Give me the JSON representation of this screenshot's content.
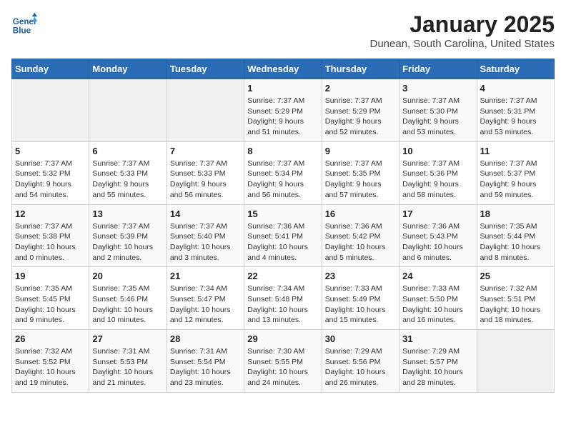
{
  "header": {
    "logo_line1": "General",
    "logo_line2": "Blue",
    "month": "January 2025",
    "location": "Dunean, South Carolina, United States"
  },
  "days_of_week": [
    "Sunday",
    "Monday",
    "Tuesday",
    "Wednesday",
    "Thursday",
    "Friday",
    "Saturday"
  ],
  "weeks": [
    [
      {
        "day": "",
        "info": ""
      },
      {
        "day": "",
        "info": ""
      },
      {
        "day": "",
        "info": ""
      },
      {
        "day": "1",
        "info": "Sunrise: 7:37 AM\nSunset: 5:29 PM\nDaylight: 9 hours\nand 51 minutes."
      },
      {
        "day": "2",
        "info": "Sunrise: 7:37 AM\nSunset: 5:29 PM\nDaylight: 9 hours\nand 52 minutes."
      },
      {
        "day": "3",
        "info": "Sunrise: 7:37 AM\nSunset: 5:30 PM\nDaylight: 9 hours\nand 53 minutes."
      },
      {
        "day": "4",
        "info": "Sunrise: 7:37 AM\nSunset: 5:31 PM\nDaylight: 9 hours\nand 53 minutes."
      }
    ],
    [
      {
        "day": "5",
        "info": "Sunrise: 7:37 AM\nSunset: 5:32 PM\nDaylight: 9 hours\nand 54 minutes."
      },
      {
        "day": "6",
        "info": "Sunrise: 7:37 AM\nSunset: 5:33 PM\nDaylight: 9 hours\nand 55 minutes."
      },
      {
        "day": "7",
        "info": "Sunrise: 7:37 AM\nSunset: 5:33 PM\nDaylight: 9 hours\nand 56 minutes."
      },
      {
        "day": "8",
        "info": "Sunrise: 7:37 AM\nSunset: 5:34 PM\nDaylight: 9 hours\nand 56 minutes."
      },
      {
        "day": "9",
        "info": "Sunrise: 7:37 AM\nSunset: 5:35 PM\nDaylight: 9 hours\nand 57 minutes."
      },
      {
        "day": "10",
        "info": "Sunrise: 7:37 AM\nSunset: 5:36 PM\nDaylight: 9 hours\nand 58 minutes."
      },
      {
        "day": "11",
        "info": "Sunrise: 7:37 AM\nSunset: 5:37 PM\nDaylight: 9 hours\nand 59 minutes."
      }
    ],
    [
      {
        "day": "12",
        "info": "Sunrise: 7:37 AM\nSunset: 5:38 PM\nDaylight: 10 hours\nand 0 minutes."
      },
      {
        "day": "13",
        "info": "Sunrise: 7:37 AM\nSunset: 5:39 PM\nDaylight: 10 hours\nand 2 minutes."
      },
      {
        "day": "14",
        "info": "Sunrise: 7:37 AM\nSunset: 5:40 PM\nDaylight: 10 hours\nand 3 minutes."
      },
      {
        "day": "15",
        "info": "Sunrise: 7:36 AM\nSunset: 5:41 PM\nDaylight: 10 hours\nand 4 minutes."
      },
      {
        "day": "16",
        "info": "Sunrise: 7:36 AM\nSunset: 5:42 PM\nDaylight: 10 hours\nand 5 minutes."
      },
      {
        "day": "17",
        "info": "Sunrise: 7:36 AM\nSunset: 5:43 PM\nDaylight: 10 hours\nand 6 minutes."
      },
      {
        "day": "18",
        "info": "Sunrise: 7:35 AM\nSunset: 5:44 PM\nDaylight: 10 hours\nand 8 minutes."
      }
    ],
    [
      {
        "day": "19",
        "info": "Sunrise: 7:35 AM\nSunset: 5:45 PM\nDaylight: 10 hours\nand 9 minutes."
      },
      {
        "day": "20",
        "info": "Sunrise: 7:35 AM\nSunset: 5:46 PM\nDaylight: 10 hours\nand 10 minutes."
      },
      {
        "day": "21",
        "info": "Sunrise: 7:34 AM\nSunset: 5:47 PM\nDaylight: 10 hours\nand 12 minutes."
      },
      {
        "day": "22",
        "info": "Sunrise: 7:34 AM\nSunset: 5:48 PM\nDaylight: 10 hours\nand 13 minutes."
      },
      {
        "day": "23",
        "info": "Sunrise: 7:33 AM\nSunset: 5:49 PM\nDaylight: 10 hours\nand 15 minutes."
      },
      {
        "day": "24",
        "info": "Sunrise: 7:33 AM\nSunset: 5:50 PM\nDaylight: 10 hours\nand 16 minutes."
      },
      {
        "day": "25",
        "info": "Sunrise: 7:32 AM\nSunset: 5:51 PM\nDaylight: 10 hours\nand 18 minutes."
      }
    ],
    [
      {
        "day": "26",
        "info": "Sunrise: 7:32 AM\nSunset: 5:52 PM\nDaylight: 10 hours\nand 19 minutes."
      },
      {
        "day": "27",
        "info": "Sunrise: 7:31 AM\nSunset: 5:53 PM\nDaylight: 10 hours\nand 21 minutes."
      },
      {
        "day": "28",
        "info": "Sunrise: 7:31 AM\nSunset: 5:54 PM\nDaylight: 10 hours\nand 23 minutes."
      },
      {
        "day": "29",
        "info": "Sunrise: 7:30 AM\nSunset: 5:55 PM\nDaylight: 10 hours\nand 24 minutes."
      },
      {
        "day": "30",
        "info": "Sunrise: 7:29 AM\nSunset: 5:56 PM\nDaylight: 10 hours\nand 26 minutes."
      },
      {
        "day": "31",
        "info": "Sunrise: 7:29 AM\nSunset: 5:57 PM\nDaylight: 10 hours\nand 28 minutes."
      },
      {
        "day": "",
        "info": ""
      }
    ]
  ]
}
